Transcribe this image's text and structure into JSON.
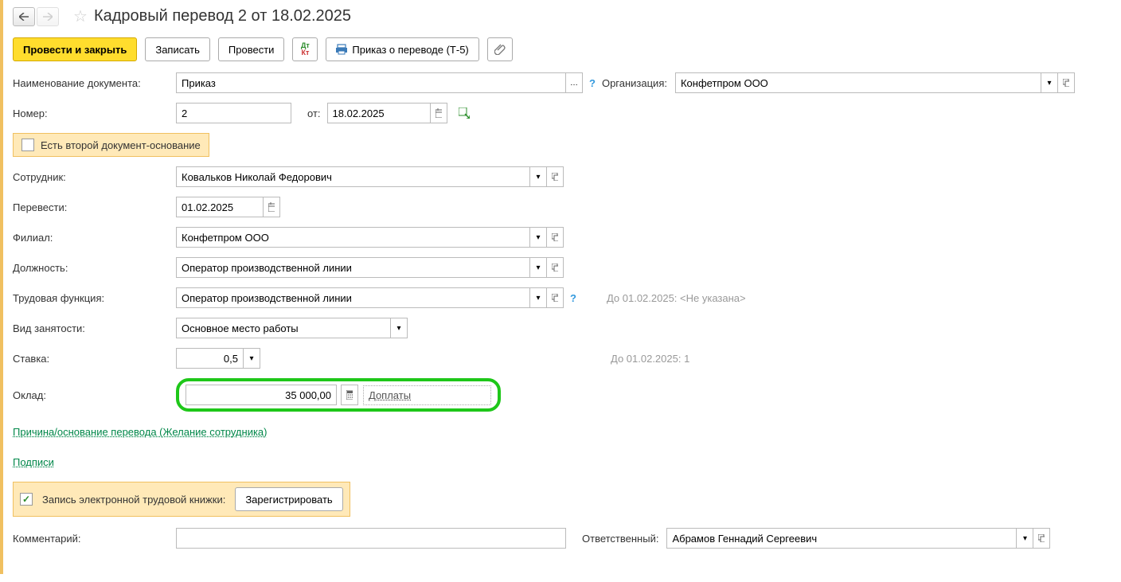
{
  "header": {
    "title": "Кадровый перевод 2 от 18.02.2025"
  },
  "toolbar": {
    "post_close": "Провести и закрыть",
    "save": "Записать",
    "post": "Провести",
    "print_order": "Приказ о переводе (Т-5)"
  },
  "fields": {
    "doc_name_label": "Наименование документа:",
    "doc_name_value": "Приказ",
    "org_label": "Организация:",
    "org_value": "Конфетпром ООО",
    "number_label": "Номер:",
    "number_value": "2",
    "from_label": "от:",
    "date_value": "18.02.2025",
    "second_basis_label": "Есть второй документ-основание",
    "employee_label": "Сотрудник:",
    "employee_value": "Ковальков Николай Федорович",
    "transfer_label": "Перевести:",
    "transfer_value": "01.02.2025",
    "branch_label": "Филиал:",
    "branch_value": "Конфетпром ООО",
    "position_label": "Должность:",
    "position_value": "Оператор производственной линии",
    "function_label": "Трудовая функция:",
    "function_value": "Оператор производственной линии",
    "function_hint": "До 01.02.2025: <Не указана>",
    "employment_label": "Вид занятости:",
    "employment_value": "Основное место работы",
    "rate_label": "Ставка:",
    "rate_value": "0,5",
    "rate_hint": "До 01.02.2025: 1",
    "salary_label": "Оклад:",
    "salary_value": "35 000,00",
    "addpay_link": "Доплаты",
    "reason_link": "Причина/основание перевода (Желание сотрудника)",
    "signatures_link": "Подписи",
    "etk_label": "Запись электронной трудовой книжки:",
    "etk_button": "Зарегистрировать",
    "comment_label": "Комментарий:",
    "responsible_label": "Ответственный:",
    "responsible_value": "Абрамов Геннадий Сергеевич"
  }
}
